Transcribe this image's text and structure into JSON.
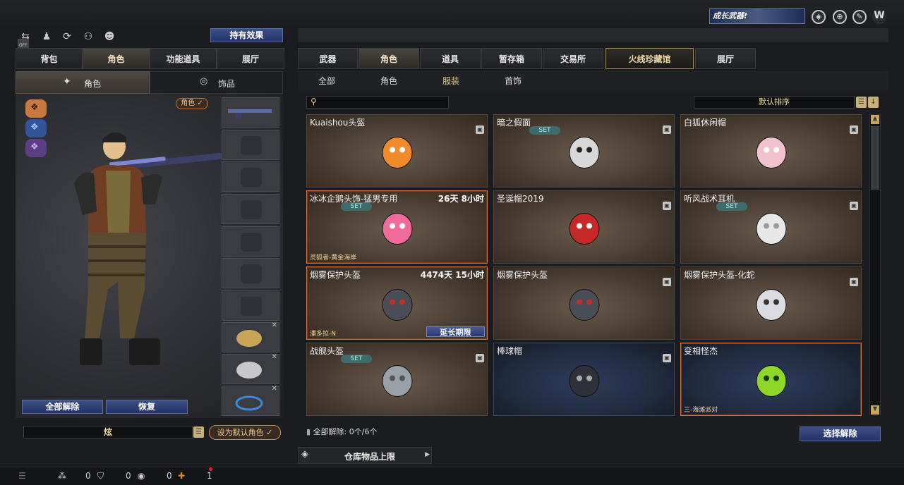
{
  "top": {
    "banner_text": "成长武器!",
    "icons": [
      "shield-icon",
      "globe-icon",
      "tools-icon",
      "logo-w-icon"
    ]
  },
  "left": {
    "tool_icons": [
      "toggle-icon",
      "group-icon",
      "cycle-icon",
      "person-icon",
      "penguin-icon"
    ],
    "toggle_label": "OFF",
    "effect_button": "持有效果",
    "tabs": [
      "背包",
      "角色",
      "功能道具",
      "展厅"
    ],
    "subtabs": [
      "角色",
      "饰品"
    ],
    "filter_icons": [
      "wolf-icon",
      "bird-icon",
      "eagle-icon"
    ],
    "role_badge": "角色 ✓",
    "unequip_all": "全部解除",
    "restore": "恢复",
    "role_name": "炫",
    "set_default": "设为默认角色 ✓"
  },
  "right": {
    "tabs": [
      "武器",
      "角色",
      "道具",
      "暂存箱",
      "交易所",
      "火线珍藏馆",
      "展厅"
    ],
    "subtabs": [
      "全部",
      "角色",
      "服装",
      "首饰"
    ],
    "search_placeholder": "",
    "sort_label": "默认排序",
    "items": [
      {
        "name": "Kuaishou头盔",
        "time": "",
        "set": false,
        "lock": true,
        "bottom": "",
        "extend": "",
        "icon": "kuaishou-helmet-icon"
      },
      {
        "name": "暗之假面",
        "time": "",
        "set": true,
        "lock": true,
        "bottom": "",
        "extend": "",
        "icon": "dark-mask-icon"
      },
      {
        "name": "白狐休闲帽",
        "time": "",
        "set": false,
        "lock": true,
        "bottom": "",
        "extend": "",
        "icon": "white-fox-hat-icon"
      },
      {
        "name": "冰冰企鹅头饰-猛男专用",
        "time": "26天 8小时",
        "set": true,
        "lock": false,
        "bottom": "灵狐者-黄金海岸",
        "extend": "",
        "icon": "penguin-headwear-icon"
      },
      {
        "name": "圣诞帽2019",
        "time": "",
        "set": false,
        "lock": true,
        "bottom": "",
        "extend": "",
        "icon": "christmas-hat-icon"
      },
      {
        "name": "听风战术耳机",
        "time": "",
        "set": true,
        "lock": true,
        "bottom": "",
        "extend": "",
        "icon": "headphones-icon"
      },
      {
        "name": "烟雾保护头盔",
        "time": "4474天 15小时",
        "set": false,
        "lock": false,
        "bottom": "潘多拉-N",
        "extend": "延长期限",
        "icon": "smoke-helmet-icon"
      },
      {
        "name": "烟雾保护头盔",
        "time": "",
        "set": false,
        "lock": true,
        "bottom": "",
        "extend": "",
        "icon": "smoke-helmet-icon"
      },
      {
        "name": "烟雾保护头盔-化蛇",
        "time": "",
        "set": false,
        "lock": true,
        "bottom": "",
        "extend": "",
        "icon": "smoke-helmet-white-icon"
      },
      {
        "name": "战舰头盔",
        "time": "",
        "set": true,
        "lock": true,
        "bottom": "",
        "extend": "",
        "icon": "battleship-helmet-icon"
      },
      {
        "name": "棒球帽",
        "time": "",
        "set": false,
        "lock": true,
        "bottom": "",
        "extend": "",
        "icon": "baseball-cap-icon"
      },
      {
        "name": "变相怪杰",
        "time": "",
        "set": false,
        "lock": false,
        "bottom": "三-海滩派对",
        "extend": "",
        "icon": "green-mask-icon"
      }
    ],
    "unequip_status": "全部解除: 0个/6个",
    "select_unequip": "选择解除",
    "warehouse_limit": "仓库物品上限"
  },
  "bottom": {
    "counts": [
      "0",
      "0",
      "0",
      "1"
    ]
  }
}
